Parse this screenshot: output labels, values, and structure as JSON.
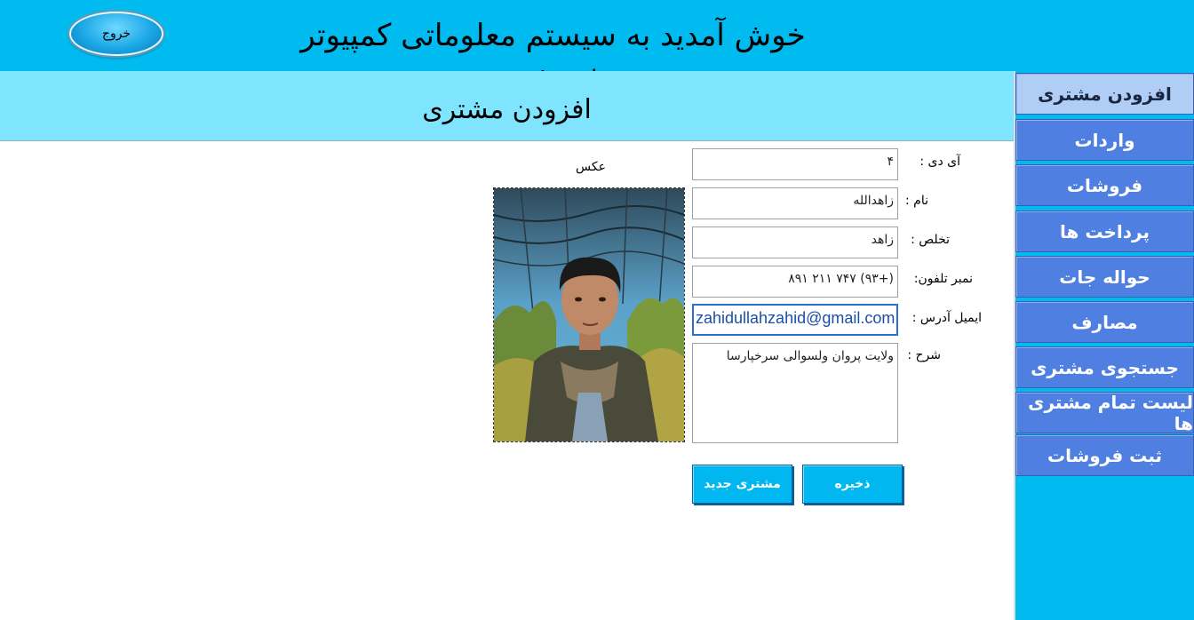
{
  "header": {
    "title": "خوش آمدید به سیستم معلوماتی کمپیوتر فروشی",
    "exit_label": "خروج"
  },
  "sidebar": {
    "items": [
      {
        "label": "افزودن مشتری",
        "active": true
      },
      {
        "label": "واردات"
      },
      {
        "label": "فروشات"
      },
      {
        "label": "پرداخت ها"
      },
      {
        "label": "حواله جات"
      },
      {
        "label": "مصارف"
      },
      {
        "label": "جستجوی مشتری"
      },
      {
        "label": "لیست تمام مشتری ها"
      },
      {
        "label": "ثبت فروشات"
      }
    ]
  },
  "page": {
    "title": "افزودن مشتری"
  },
  "form": {
    "id": {
      "label": "آی دی :",
      "value": "۴"
    },
    "name": {
      "label": "نام :",
      "value": "زاهدالله"
    },
    "family": {
      "label": "تخلص :",
      "value": "زاهد"
    },
    "phone": {
      "label": "نمبر تلفون:",
      "value": "(+۹۳) ۷۴۷ ۲۱۱ ۸۹۱"
    },
    "email": {
      "label": "ایمیل آدرس :",
      "value": "zahidullahzahid@gmail.com"
    },
    "desc": {
      "label": "شرح :",
      "value": "ولایت پروان ولسوالی سرخپارسا"
    },
    "photo_label": "عکس"
  },
  "buttons": {
    "save": "ذخیره",
    "new_customer": "مشتری جدید"
  },
  "colors": {
    "header": "#00bbf0",
    "page_bar": "#7fe5ff",
    "sidebar_item": "#4f7fe0",
    "sidebar_active": "#b0cdf5",
    "button": "#00b8ef"
  }
}
